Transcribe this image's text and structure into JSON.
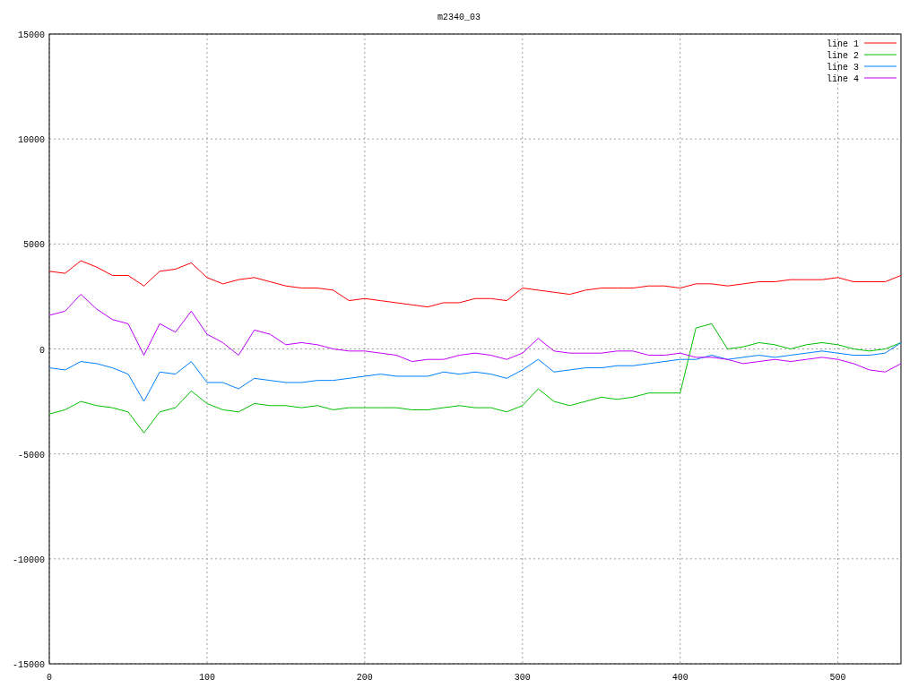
{
  "plot": {
    "chart_data": {
      "type": "line",
      "grid": true,
      "legend": "upper right",
      "title": "m2340_03",
      "x": [
        0,
        10,
        20,
        30,
        40,
        50,
        60,
        70,
        80,
        90,
        100,
        110,
        120,
        130,
        140,
        150,
        160,
        170,
        180,
        190,
        200,
        210,
        220,
        230,
        240,
        250,
        260,
        270,
        280,
        290,
        300,
        310,
        320,
        330,
        340,
        350,
        360,
        370,
        380,
        390,
        400,
        410,
        420,
        430,
        440,
        450,
        460,
        470,
        480,
        490,
        500,
        510,
        520,
        530,
        540
      ],
      "series": [
        {
          "name": "line 1",
          "color": "#ff0000",
          "values": [
            3700,
            3600,
            4200,
            3900,
            3500,
            3500,
            3000,
            3700,
            3800,
            4100,
            3400,
            3100,
            3300,
            3400,
            3200,
            3000,
            2900,
            2900,
            2800,
            2300,
            2400,
            2300,
            2200,
            2100,
            2000,
            2200,
            2200,
            2400,
            2400,
            2300,
            2900,
            2800,
            2700,
            2600,
            2800,
            2900,
            2900,
            2900,
            3000,
            3000,
            2900,
            3100,
            3100,
            3000,
            3100,
            3200,
            3200,
            3300,
            3300,
            3300,
            3400,
            3200,
            3200,
            3200,
            3500
          ]
        },
        {
          "name": "line 2",
          "color": "#00c000",
          "values": [
            -3100,
            -2900,
            -2500,
            -2700,
            -2800,
            -3000,
            -4000,
            -3000,
            -2800,
            -2000,
            -2600,
            -2900,
            -3000,
            -2600,
            -2700,
            -2700,
            -2800,
            -2700,
            -2900,
            -2800,
            -2800,
            -2800,
            -2800,
            -2900,
            -2900,
            -2800,
            -2700,
            -2800,
            -2800,
            -3000,
            -2700,
            -1900,
            -2500,
            -2700,
            -2500,
            -2300,
            -2400,
            -2300,
            -2100,
            -2100,
            -2100,
            1000,
            1200,
            0,
            100,
            300,
            200,
            0,
            200,
            300,
            200,
            0,
            -100,
            0,
            300
          ]
        },
        {
          "name": "line 3",
          "color": "#0080ff",
          "values": [
            -900,
            -1000,
            -600,
            -700,
            -900,
            -1200,
            -2500,
            -1100,
            -1200,
            -600,
            -1600,
            -1600,
            -1900,
            -1400,
            -1500,
            -1600,
            -1600,
            -1500,
            -1500,
            -1400,
            -1300,
            -1200,
            -1300,
            -1300,
            -1300,
            -1100,
            -1200,
            -1100,
            -1200,
            -1400,
            -1000,
            -500,
            -1100,
            -1000,
            -900,
            -900,
            -800,
            -800,
            -700,
            -600,
            -500,
            -500,
            -300,
            -500,
            -400,
            -300,
            -400,
            -300,
            -200,
            -100,
            -200,
            -300,
            -300,
            -200,
            300
          ]
        },
        {
          "name": "line 4",
          "color": "#c000ff",
          "values": [
            1600,
            1800,
            2600,
            1900,
            1400,
            1200,
            -300,
            1200,
            800,
            1800,
            700,
            300,
            -300,
            900,
            700,
            200,
            300,
            200,
            0,
            -100,
            -100,
            -200,
            -300,
            -600,
            -500,
            -500,
            -300,
            -200,
            -300,
            -500,
            -200,
            500,
            -100,
            -200,
            -200,
            -200,
            -100,
            -100,
            -300,
            -300,
            -200,
            -400,
            -400,
            -500,
            -700,
            -600,
            -500,
            -600,
            -500,
            -400,
            -500,
            -700,
            -1000,
            -1100,
            -700
          ]
        }
      ],
      "xlim": [
        0,
        540
      ],
      "ylim": [
        -15000,
        15000
      ],
      "xticks": [
        0,
        100,
        200,
        300,
        400,
        500
      ],
      "yticks": [
        -15000,
        -10000,
        -5000,
        0,
        5000,
        10000,
        15000
      ]
    }
  }
}
